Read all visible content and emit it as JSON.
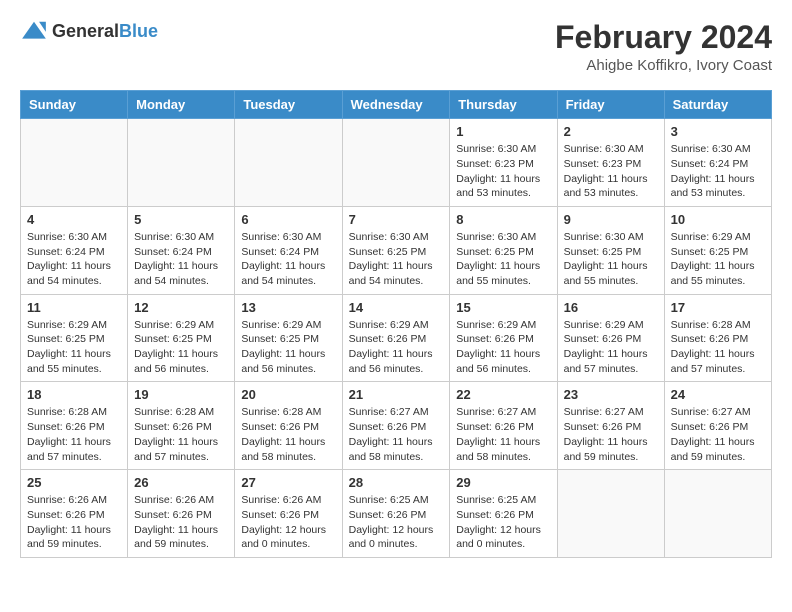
{
  "logo": {
    "general": "General",
    "blue": "Blue"
  },
  "title": "February 2024",
  "subtitle": "Ahigbe Koffikro, Ivory Coast",
  "days_of_week": [
    "Sunday",
    "Monday",
    "Tuesday",
    "Wednesday",
    "Thursday",
    "Friday",
    "Saturday"
  ],
  "weeks": [
    [
      {
        "day": "",
        "info": ""
      },
      {
        "day": "",
        "info": ""
      },
      {
        "day": "",
        "info": ""
      },
      {
        "day": "",
        "info": ""
      },
      {
        "day": "1",
        "info": "Sunrise: 6:30 AM\nSunset: 6:23 PM\nDaylight: 11 hours and 53 minutes."
      },
      {
        "day": "2",
        "info": "Sunrise: 6:30 AM\nSunset: 6:23 PM\nDaylight: 11 hours and 53 minutes."
      },
      {
        "day": "3",
        "info": "Sunrise: 6:30 AM\nSunset: 6:24 PM\nDaylight: 11 hours and 53 minutes."
      }
    ],
    [
      {
        "day": "4",
        "info": "Sunrise: 6:30 AM\nSunset: 6:24 PM\nDaylight: 11 hours and 54 minutes."
      },
      {
        "day": "5",
        "info": "Sunrise: 6:30 AM\nSunset: 6:24 PM\nDaylight: 11 hours and 54 minutes."
      },
      {
        "day": "6",
        "info": "Sunrise: 6:30 AM\nSunset: 6:24 PM\nDaylight: 11 hours and 54 minutes."
      },
      {
        "day": "7",
        "info": "Sunrise: 6:30 AM\nSunset: 6:25 PM\nDaylight: 11 hours and 54 minutes."
      },
      {
        "day": "8",
        "info": "Sunrise: 6:30 AM\nSunset: 6:25 PM\nDaylight: 11 hours and 55 minutes."
      },
      {
        "day": "9",
        "info": "Sunrise: 6:30 AM\nSunset: 6:25 PM\nDaylight: 11 hours and 55 minutes."
      },
      {
        "day": "10",
        "info": "Sunrise: 6:29 AM\nSunset: 6:25 PM\nDaylight: 11 hours and 55 minutes."
      }
    ],
    [
      {
        "day": "11",
        "info": "Sunrise: 6:29 AM\nSunset: 6:25 PM\nDaylight: 11 hours and 55 minutes."
      },
      {
        "day": "12",
        "info": "Sunrise: 6:29 AM\nSunset: 6:25 PM\nDaylight: 11 hours and 56 minutes."
      },
      {
        "day": "13",
        "info": "Sunrise: 6:29 AM\nSunset: 6:25 PM\nDaylight: 11 hours and 56 minutes."
      },
      {
        "day": "14",
        "info": "Sunrise: 6:29 AM\nSunset: 6:26 PM\nDaylight: 11 hours and 56 minutes."
      },
      {
        "day": "15",
        "info": "Sunrise: 6:29 AM\nSunset: 6:26 PM\nDaylight: 11 hours and 56 minutes."
      },
      {
        "day": "16",
        "info": "Sunrise: 6:29 AM\nSunset: 6:26 PM\nDaylight: 11 hours and 57 minutes."
      },
      {
        "day": "17",
        "info": "Sunrise: 6:28 AM\nSunset: 6:26 PM\nDaylight: 11 hours and 57 minutes."
      }
    ],
    [
      {
        "day": "18",
        "info": "Sunrise: 6:28 AM\nSunset: 6:26 PM\nDaylight: 11 hours and 57 minutes."
      },
      {
        "day": "19",
        "info": "Sunrise: 6:28 AM\nSunset: 6:26 PM\nDaylight: 11 hours and 57 minutes."
      },
      {
        "day": "20",
        "info": "Sunrise: 6:28 AM\nSunset: 6:26 PM\nDaylight: 11 hours and 58 minutes."
      },
      {
        "day": "21",
        "info": "Sunrise: 6:27 AM\nSunset: 6:26 PM\nDaylight: 11 hours and 58 minutes."
      },
      {
        "day": "22",
        "info": "Sunrise: 6:27 AM\nSunset: 6:26 PM\nDaylight: 11 hours and 58 minutes."
      },
      {
        "day": "23",
        "info": "Sunrise: 6:27 AM\nSunset: 6:26 PM\nDaylight: 11 hours and 59 minutes."
      },
      {
        "day": "24",
        "info": "Sunrise: 6:27 AM\nSunset: 6:26 PM\nDaylight: 11 hours and 59 minutes."
      }
    ],
    [
      {
        "day": "25",
        "info": "Sunrise: 6:26 AM\nSunset: 6:26 PM\nDaylight: 11 hours and 59 minutes."
      },
      {
        "day": "26",
        "info": "Sunrise: 6:26 AM\nSunset: 6:26 PM\nDaylight: 11 hours and 59 minutes."
      },
      {
        "day": "27",
        "info": "Sunrise: 6:26 AM\nSunset: 6:26 PM\nDaylight: 12 hours and 0 minutes."
      },
      {
        "day": "28",
        "info": "Sunrise: 6:25 AM\nSunset: 6:26 PM\nDaylight: 12 hours and 0 minutes."
      },
      {
        "day": "29",
        "info": "Sunrise: 6:25 AM\nSunset: 6:26 PM\nDaylight: 12 hours and 0 minutes."
      },
      {
        "day": "",
        "info": ""
      },
      {
        "day": "",
        "info": ""
      }
    ]
  ]
}
